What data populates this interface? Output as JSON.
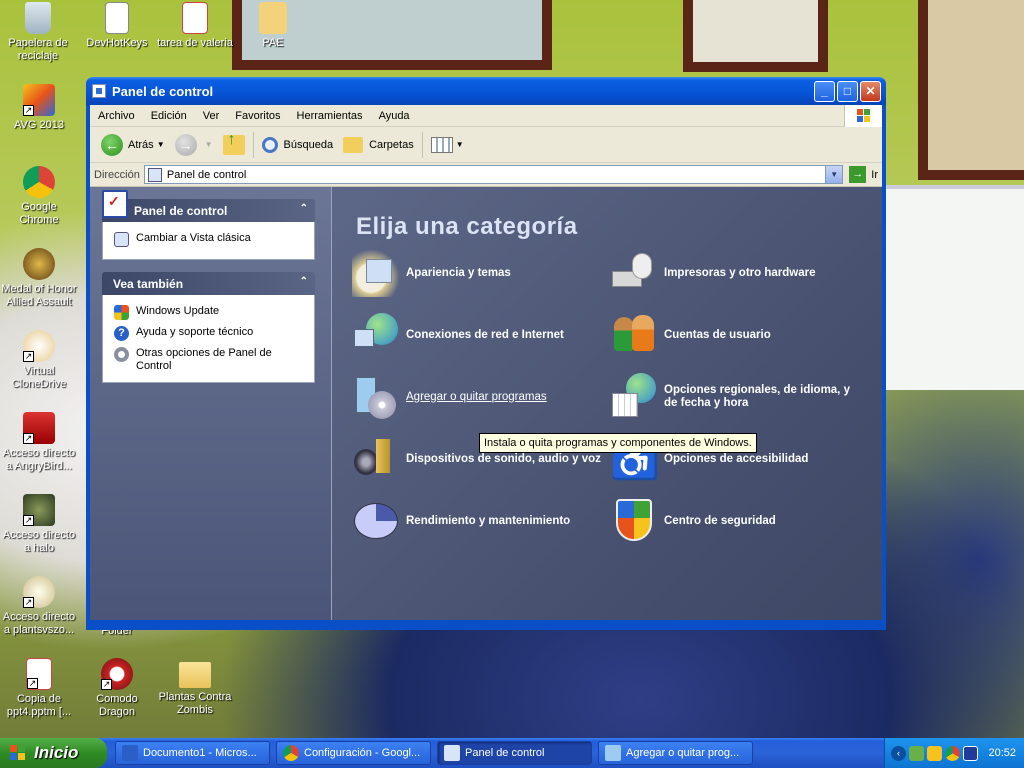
{
  "desktop": {
    "icons": [
      {
        "label": "Papelera de reciclaje"
      },
      {
        "label": "DevHotKeys"
      },
      {
        "label": "tarea de valeria"
      },
      {
        "label": "PAE"
      },
      {
        "label": "AVG 2013"
      },
      {
        "label": "Google Chrome"
      },
      {
        "label": "Medal of Honor Allied Assault"
      },
      {
        "label": "Virtual CloneDrive"
      },
      {
        "label": "Acceso directo a AngryBird..."
      },
      {
        "label": "Acceso directo a halo"
      },
      {
        "label": "Acceso directo a plantsvszo..."
      },
      {
        "label": "Folder"
      },
      {
        "label": "Copia de ppt4.pptm [..."
      },
      {
        "label": "Comodo Dragon"
      },
      {
        "label": "Plantas Contra Zombis"
      }
    ]
  },
  "window": {
    "title": "Panel de control",
    "menu": [
      "Archivo",
      "Edición",
      "Ver",
      "Favoritos",
      "Herramientas",
      "Ayuda"
    ],
    "toolbar": {
      "back": "Atrás",
      "search": "Búsqueda",
      "folders": "Carpetas"
    },
    "address": {
      "label": "Dirección",
      "value": "Panel de control",
      "go": "Ir"
    },
    "left_pane": {
      "control_panel_title": "Panel de control",
      "switch_view": "Cambiar a Vista clásica",
      "see_also_title": "Vea también",
      "see_also": [
        "Windows Update",
        "Ayuda y soporte técnico",
        "Otras opciones de Panel de Control"
      ]
    },
    "main": {
      "heading": "Elija una categoría",
      "categories": [
        {
          "label": "Apariencia y temas",
          "icon": "appearance-icon"
        },
        {
          "label": "Impresoras y otro hardware",
          "icon": "printer-icon"
        },
        {
          "label": "Conexiones de red e Internet",
          "icon": "network-icon"
        },
        {
          "label": "Cuentas de usuario",
          "icon": "users-icon"
        },
        {
          "label": "Agregar o quitar programas",
          "icon": "add-remove-programs-icon"
        },
        {
          "label": "Opciones regionales, de idioma, y de fecha y hora",
          "icon": "regional-icon"
        },
        {
          "label": "Dispositivos de sonido, audio y voz",
          "icon": "sound-icon"
        },
        {
          "label": "Opciones de accesibilidad",
          "icon": "accessibility-icon"
        },
        {
          "label": "Rendimiento y mantenimiento",
          "icon": "performance-icon"
        },
        {
          "label": "Centro de seguridad",
          "icon": "security-center-icon"
        }
      ],
      "tooltip": "Instala o quita programas y componentes de Windows."
    }
  },
  "taskbar": {
    "start": "Inicio",
    "tasks": [
      "Documento1 - Micros...",
      "Configuración - Googl...",
      "Panel de control",
      "Agregar o quitar prog..."
    ],
    "clock": "20:52"
  },
  "colors": {
    "title_blue": "#0a4fc8",
    "pane_slate": "#5d6787",
    "taskbar_blue": "#245edb",
    "start_green": "#3ea334"
  }
}
